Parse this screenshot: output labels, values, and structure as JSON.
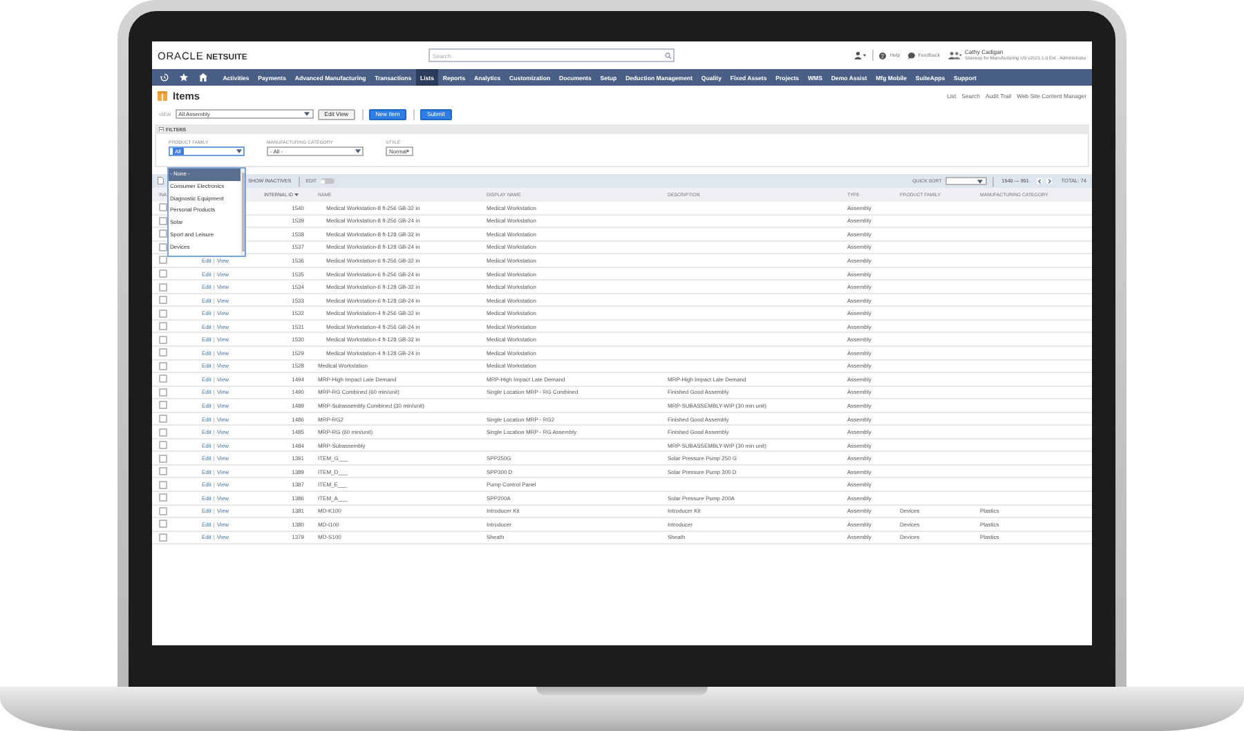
{
  "header": {
    "logo_left": "ORACLE",
    "logo_right": "NETSUITE",
    "search": {
      "placeholder": "Search"
    },
    "links": [
      "Help",
      "Feedback"
    ],
    "user": {
      "name": "Cathy Cadigan",
      "role": "Stairway for Manufacturing US v2021.1.0 Ext - Administrator"
    }
  },
  "nav": {
    "items": [
      {
        "label": "Activities",
        "selected": false
      },
      {
        "label": "Payments",
        "selected": false
      },
      {
        "label": "Advanced Manufacturing",
        "selected": false
      },
      {
        "label": "Transactions",
        "selected": false
      },
      {
        "label": "Lists",
        "selected": true
      },
      {
        "label": "Reports",
        "selected": false
      },
      {
        "label": "Analytics",
        "selected": false
      },
      {
        "label": "Customization",
        "selected": false
      },
      {
        "label": "Documents",
        "selected": false
      },
      {
        "label": "Setup",
        "selected": false
      },
      {
        "label": "Deduction Management",
        "selected": false
      },
      {
        "label": "Quality",
        "selected": false
      },
      {
        "label": "Fixed Assets",
        "selected": false
      },
      {
        "label": "Projects",
        "selected": false
      },
      {
        "label": "WMS",
        "selected": false
      },
      {
        "label": "Demo Assist",
        "selected": false
      },
      {
        "label": "Mfg Mobile",
        "selected": false
      },
      {
        "label": "SuiteApps",
        "selected": false
      },
      {
        "label": "Support",
        "selected": false
      }
    ]
  },
  "page": {
    "title": "Items",
    "links": [
      "List",
      "Search",
      "Audit Trail",
      "Web Site Content Manager"
    ]
  },
  "view": {
    "label": "VIEW",
    "value": "All Assembly",
    "buttons": [
      {
        "label": "Edit View",
        "kind": "secondary"
      },
      {
        "label": "New Item",
        "kind": "primary"
      },
      {
        "label": "Submit",
        "kind": "primary"
      }
    ]
  },
  "filters": {
    "title": "FILTERS",
    "expanded": true,
    "fields": [
      {
        "label": "PRODUCT FAMILY",
        "value": "All",
        "open": true
      },
      {
        "label": "MANUFACTURING CATEGORY",
        "value": "- All -",
        "open": false
      },
      {
        "label": "STYLE",
        "value": "Normal",
        "open": false
      }
    ],
    "dropdown": [
      {
        "label": "- None -",
        "selected": true
      },
      {
        "label": "Consumer Electronics",
        "selected": false
      },
      {
        "label": "Diagnostic Equipment",
        "selected": false
      },
      {
        "label": "Personal Products",
        "selected": false
      },
      {
        "label": "Solar",
        "selected": false
      },
      {
        "label": "Sport and Leisure",
        "selected": false
      },
      {
        "label": "Devices",
        "selected": false
      }
    ]
  },
  "toolbar": {
    "show_inactives": "SHOW INACTIVES",
    "edit": {
      "label": "EDIT",
      "on": false
    },
    "quick_sort": "QUICK SORT",
    "range": "1540 — 951",
    "total": "TOTAL: 74"
  },
  "table": {
    "action_separator": "|",
    "columns": [
      {
        "label": "INA",
        "sorted": false
      },
      {
        "label": "INTERNAL ID",
        "sorted": true
      },
      {
        "label": "NAME",
        "sorted": false
      },
      {
        "label": "DISPLAY NAME",
        "sorted": false
      },
      {
        "label": "DESCRIPTION",
        "sorted": false
      },
      {
        "label": "TYPE",
        "sorted": false
      },
      {
        "label": "PRODUCT FAMILY",
        "sorted": false
      },
      {
        "label": "MANUFACTURING CATEGORY",
        "sorted": false
      }
    ],
    "rows": [
      {
        "checked": false,
        "kind": "variant",
        "id": "1540",
        "name": "Medical Workstation-8 ft-256 GB-32 in",
        "display_name": "Medical Workstation",
        "type": "Assembly"
      },
      {
        "checked": false,
        "kind": "variant",
        "id": "1539",
        "name": "Medical Workstation-8 ft-256 GB-24 in",
        "display_name": "Medical Workstation",
        "type": "Assembly"
      },
      {
        "checked": false,
        "kind": "variant",
        "id": "1538",
        "name": "Medical Workstation-8 ft-128 GB-32 in",
        "display_name": "Medical Workstation",
        "type": "Assembly"
      },
      {
        "checked": false,
        "kind": "variant",
        "id": "1537",
        "name": "Medical Workstation-8 ft-128 GB-24 in",
        "display_name": "Medical Workstation",
        "type": "Assembly"
      },
      {
        "checked": false,
        "kind": "variant",
        "actions": [
          "Edit",
          "View"
        ],
        "id": "1536",
        "name": "Medical Workstation-6 ft-256 GB-32 in",
        "display_name": "Medical Workstation",
        "type": "Assembly"
      },
      {
        "checked": false,
        "kind": "variant",
        "actions": [
          "Edit",
          "View"
        ],
        "id": "1535",
        "name": "Medical Workstation-6 ft-256 GB-24 in",
        "display_name": "Medical Workstation",
        "type": "Assembly"
      },
      {
        "checked": false,
        "kind": "variant",
        "actions": [
          "Edit",
          "View"
        ],
        "id": "1534",
        "name": "Medical Workstation-6 ft-128 GB-32 in",
        "display_name": "Medical Workstation",
        "type": "Assembly"
      },
      {
        "checked": false,
        "kind": "variant",
        "actions": [
          "Edit",
          "View"
        ],
        "id": "1533",
        "name": "Medical Workstation-6 ft-128 GB-24 in",
        "display_name": "Medical Workstation",
        "type": "Assembly"
      },
      {
        "checked": false,
        "kind": "variant",
        "actions": [
          "Edit",
          "View"
        ],
        "id": "1532",
        "name": "Medical Workstation-4 ft-256 GB-32 in",
        "display_name": "Medical Workstation",
        "type": "Assembly"
      },
      {
        "checked": false,
        "kind": "variant",
        "actions": [
          "Edit",
          "View"
        ],
        "id": "1531",
        "name": "Medical Workstation-4 ft-256 GB-24 in",
        "display_name": "Medical Workstation",
        "type": "Assembly"
      },
      {
        "checked": false,
        "kind": "variant",
        "actions": [
          "Edit",
          "View"
        ],
        "id": "1530",
        "name": "Medical Workstation-4 ft-128 GB-32 in",
        "display_name": "Medical Workstation",
        "type": "Assembly"
      },
      {
        "checked": false,
        "kind": "variant",
        "actions": [
          "Edit",
          "View"
        ],
        "id": "1529",
        "name": "Medical Workstation-4 ft-128 GB-24 in",
        "display_name": "Medical Workstation",
        "type": "Assembly"
      },
      {
        "checked": false,
        "kind": "item",
        "actions": [
          "Edit",
          "View"
        ],
        "id": "1528",
        "name": "Medical Workstation",
        "display_name": "Medical Workstation",
        "type": "Assembly"
      },
      {
        "checked": false,
        "kind": "item",
        "actions": [
          "Edit",
          "View"
        ],
        "id": "1494",
        "name": "MRP-High Impact Late Demand",
        "display_name": "MRP-High Impact Late Demand",
        "description": "MRP-High Impact Late Demand",
        "type": "Assembly"
      },
      {
        "checked": false,
        "kind": "item",
        "actions": [
          "Edit",
          "View"
        ],
        "id": "1490",
        "name": "MRP-RG Combined (60 min/unit)",
        "display_name": "Single Location MRP - RG Combined",
        "description": "Finished Good Assembly",
        "type": "Assembly"
      },
      {
        "checked": false,
        "kind": "item",
        "actions": [
          "Edit",
          "View"
        ],
        "id": "1489",
        "name": "MRP-Subassembly Combined (30 min/unit)",
        "description": "MRP-SUBASSEMBLY-WIP (30 min unit)",
        "type": "Assembly"
      },
      {
        "checked": false,
        "kind": "item",
        "actions": [
          "Edit",
          "View"
        ],
        "id": "1486",
        "name": "MRP-RG2",
        "display_name": "Single Location MRP - RG2",
        "description": "Finished Good Assembly",
        "type": "Assembly"
      },
      {
        "checked": false,
        "kind": "item",
        "actions": [
          "Edit",
          "View"
        ],
        "id": "1485",
        "name": "MRP-RG (60 min/unit)",
        "display_name": "Single Location MRP - RG Assembly",
        "description": "Finished Good Assembly",
        "type": "Assembly"
      },
      {
        "checked": false,
        "kind": "item",
        "actions": [
          "Edit",
          "View"
        ],
        "id": "1484",
        "name": "MRP-Subassembly",
        "description": "MRP-SUBASSEMBLY-WIP (30 min unit)",
        "type": "Assembly"
      },
      {
        "checked": false,
        "kind": "item",
        "actions": [
          "Edit",
          "View"
        ],
        "id": "1391",
        "name": "ITEM_G___",
        "display_name": "SPP250G",
        "description": "Solar Pressure Pump 250 G",
        "type": "Assembly"
      },
      {
        "checked": false,
        "kind": "item",
        "actions": [
          "Edit",
          "View"
        ],
        "id": "1389",
        "name": "ITEM_D___",
        "display_name": "SPP300 D",
        "description": "Solar Pressure Pump 300 D",
        "type": "Assembly"
      },
      {
        "checked": false,
        "kind": "item",
        "actions": [
          "Edit",
          "View"
        ],
        "id": "1387",
        "name": "ITEM_E___",
        "display_name": "Pump Control Panel",
        "type": "Assembly"
      },
      {
        "checked": false,
        "kind": "item",
        "actions": [
          "Edit",
          "View"
        ],
        "id": "1386",
        "name": "ITEM_A___",
        "display_name": "SPP200A",
        "description": "Solar Pressure Pump 200A",
        "type": "Assembly"
      },
      {
        "checked": false,
        "kind": "item",
        "actions": [
          "Edit",
          "View"
        ],
        "id": "1381",
        "name": "MD-K100",
        "display_name": "Introducer Kit",
        "description": "Introducer Kit",
        "type": "Assembly",
        "product_family": "Devices",
        "mfg_category": "Plastics"
      },
      {
        "checked": false,
        "kind": "item",
        "actions": [
          "Edit",
          "View"
        ],
        "id": "1380",
        "name": "MD-I100",
        "display_name": "Introducer",
        "description": "Introducer",
        "type": "Assembly",
        "product_family": "Devices",
        "mfg_category": "Plastics"
      },
      {
        "checked": false,
        "kind": "item",
        "actions": [
          "Edit",
          "View"
        ],
        "id": "1379",
        "name": "MD-S100",
        "display_name": "Sheath",
        "description": "Sheath",
        "type": "Assembly",
        "product_family": "Devices",
        "mfg_category": "Plastics"
      }
    ]
  }
}
